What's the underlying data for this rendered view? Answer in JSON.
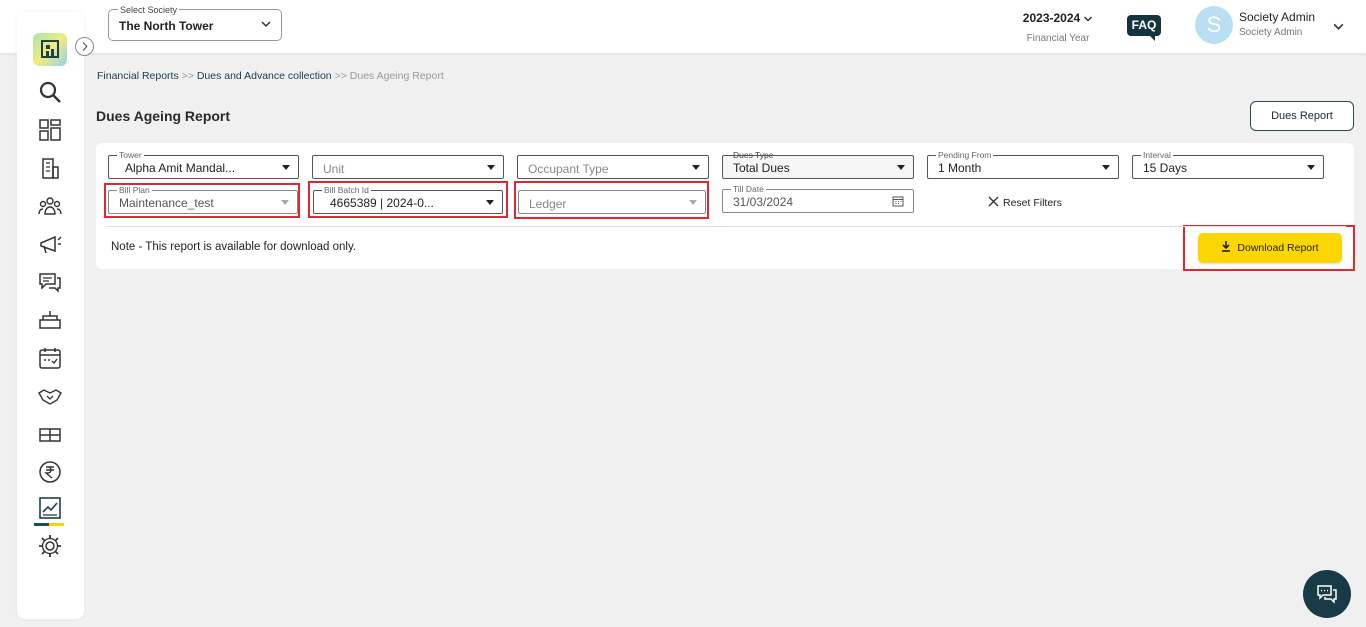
{
  "header": {
    "society_label": "Select Society",
    "society_value": "The North Tower",
    "financial_year": "2023-2024",
    "financial_year_label": "Financial Year",
    "faq": "FAQ",
    "avatar_letter": "S",
    "user_name": "Society Admin",
    "user_role": "Society Admin"
  },
  "sidebar": {
    "items": [
      "search-icon",
      "dashboard-icon",
      "building-icon",
      "residents-icon",
      "announcement-icon",
      "chat-icon",
      "facility-icon",
      "calendar-icon",
      "handshake-icon",
      "parking-icon",
      "rupee-icon",
      "reports-icon",
      "settings-icon"
    ],
    "active": "reports-icon"
  },
  "breadcrumb": {
    "item1": "Financial Reports",
    "sep1": " >> ",
    "item2": "Dues and Advance collection",
    "sep2": " >> ",
    "current": "Dues Ageing Report"
  },
  "page": {
    "title": "Dues Ageing Report",
    "dues_report_button": "Dues Report"
  },
  "filters": {
    "tower": {
      "label": "Tower",
      "value": "Alpha Amit Mandal..."
    },
    "unit": {
      "placeholder": "Unit"
    },
    "occupant_type": {
      "placeholder": "Occupant Type"
    },
    "dues_type": {
      "label": "Dues Type",
      "value": "Total Dues"
    },
    "pending_from": {
      "label": "Pending From",
      "value": "1 Month"
    },
    "interval": {
      "label": "Interval",
      "value": "15 Days"
    },
    "bill_plan": {
      "label": "Bill Plan",
      "value": "Maintenance_test"
    },
    "bill_batch_id": {
      "label": "Bill Batch Id",
      "value": "4665389 | 2024-0..."
    },
    "ledger": {
      "placeholder": "Ledger"
    },
    "till_date": {
      "label": "Till Date",
      "value": "31/03/2024"
    },
    "reset": "Reset Filters"
  },
  "note": "Note - This report is available for download only.",
  "download_button": "Download Report",
  "colors": {
    "highlight": "#e0282e",
    "download": "#fbd600",
    "brand_dark": "#193b48"
  }
}
